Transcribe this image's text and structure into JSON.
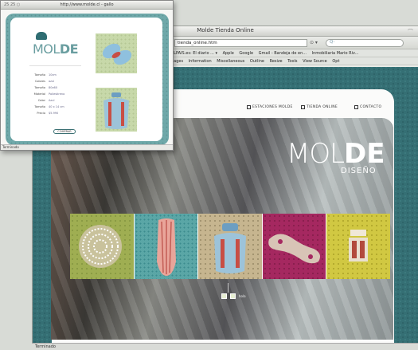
{
  "main_window": {
    "title": "Molde Tienda Online",
    "url": "tienda_online.htm",
    "search_placeholder": "Q- ",
    "nav_arrows": "⊙ ▾",
    "right_glyph": "⌒"
  },
  "bookmarks": {
    "row1": [
      "ELPAIS.es: El diario ... ▾",
      "Apple",
      "Google",
      "Gmail - Bandeja de en...",
      "Inmobiliaria Mario Riv..."
    ],
    "row2": [
      "pages",
      "Information",
      "Miscellaneous",
      "Outline",
      "Resize",
      "Tools",
      "View Source",
      "Opt"
    ]
  },
  "site": {
    "nav": [
      "ESTACIONES MOLDE",
      "TIENDA ONLINE",
      "CONTACTO"
    ],
    "logo_mol": "MOL",
    "logo_de": "DE",
    "logo_sub": "DISEÑO",
    "pager_text": "hola"
  },
  "main_status": "Terminado",
  "popup": {
    "title": "http://www.molde.cl - gallo",
    "controls": "25 25 ○",
    "logo_mol": "MOL",
    "logo_de": "DE",
    "specs": [
      {
        "k": "Tamaño",
        "v": "10cm"
      },
      {
        "k": "Colores",
        "v": "azul"
      },
      {
        "k": "Tamaño",
        "v": "80x60"
      },
      {
        "k": "Material",
        "v": "Poliestireno"
      },
      {
        "k": "Color",
        "v": "Azul"
      },
      {
        "k": "Tamaño",
        "v": "40 x 14 cm"
      },
      {
        "k": "Precio",
        "v": "$5.990"
      }
    ],
    "button": "COMPRAR",
    "status": "Terminado"
  },
  "colors": {
    "teal": "#356f74",
    "olive": "#9fae52",
    "magenta": "#a52860",
    "mustard": "#d1c842"
  }
}
